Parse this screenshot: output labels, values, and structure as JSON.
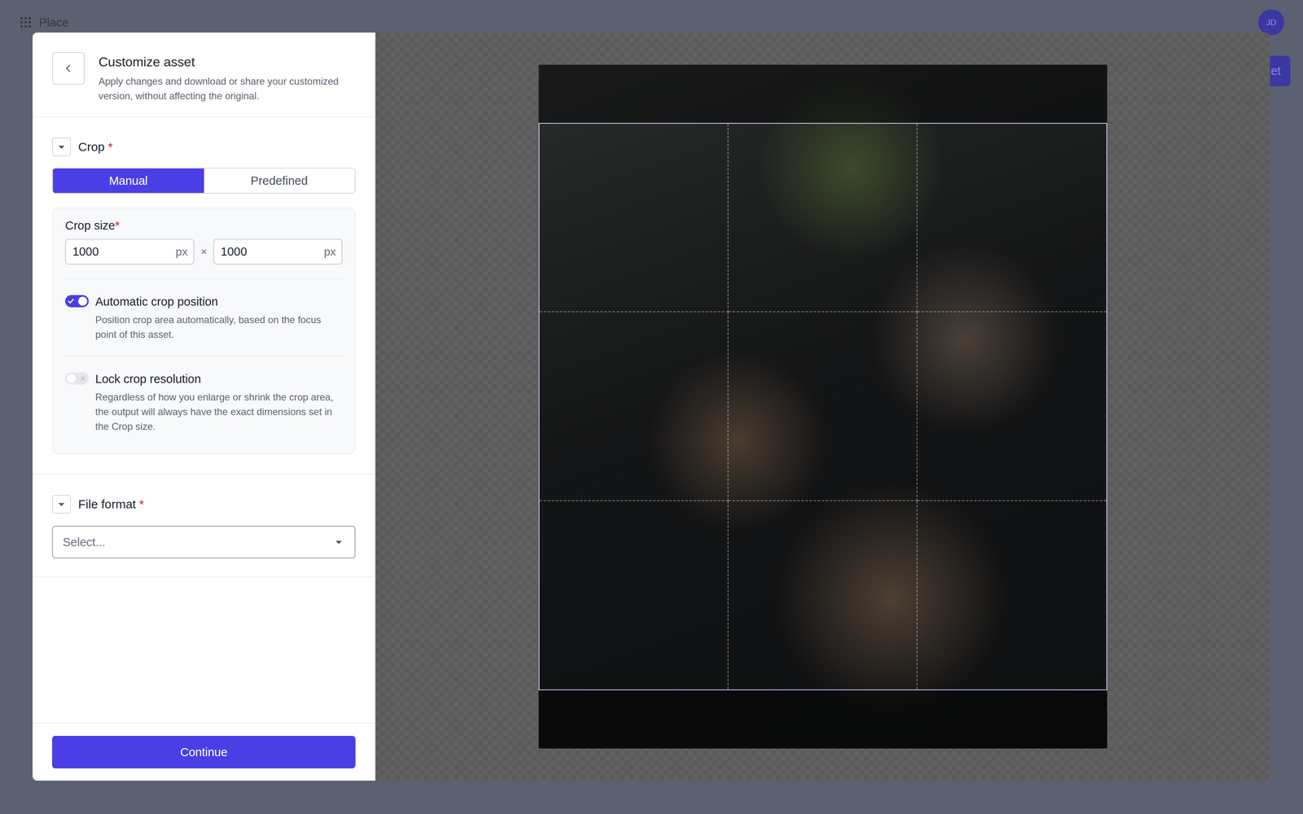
{
  "app": {
    "name": "Place",
    "avatar": "JD",
    "partial_button": "et"
  },
  "panel": {
    "title": "Customize asset",
    "subtitle": "Apply changes and download or share your customized version, without affecting the original."
  },
  "crop": {
    "label": "Crop",
    "required_mark": "*",
    "expanded": true,
    "modes": [
      {
        "label": "Manual",
        "selected": true
      },
      {
        "label": "Predefined",
        "selected": false
      }
    ],
    "size": {
      "label": "Crop size",
      "required_mark": "*",
      "width": "1000",
      "height": "1000",
      "unit": "px",
      "separator": "×"
    },
    "toggles": [
      {
        "label": "Automatic crop position",
        "description": "Position crop area automatically, based on the focus point of this asset.",
        "on": true
      },
      {
        "label": "Lock crop resolution",
        "description": "Regardless of how you enlarge or shrink the crop area, the output will always have the exact dimensions set in the Crop size.",
        "on": false
      }
    ]
  },
  "file_format": {
    "label": "File format",
    "required_mark": "*",
    "expanded": true,
    "placeholder": "Select..."
  },
  "continue_button": "Continue"
}
